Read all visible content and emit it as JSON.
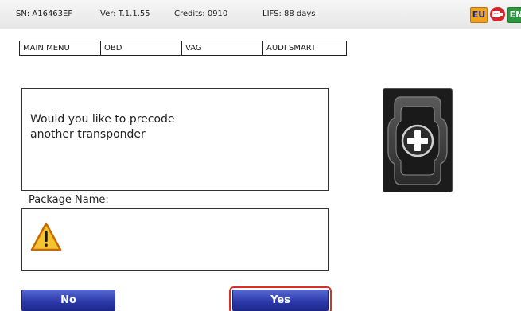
{
  "status": {
    "sn": "SN: A16463EF",
    "ver": "Ver: T.1.1.55",
    "credits": "Credits: 0910",
    "lifs": "LIFS: 88 days",
    "flag_eu": "EU",
    "flag_en": "EN"
  },
  "breadcrumb": [
    "MAIN MENU",
    "OBD",
    "VAG",
    "AUDI SMART"
  ],
  "message": {
    "line1": "Would you like to precode",
    "line2": "another transponder"
  },
  "package": {
    "label": "Package Name:"
  },
  "buttons": {
    "no": "No",
    "yes": "Yes"
  },
  "icons": {
    "usb": "usb-icon",
    "warning": "warning-icon",
    "key": "smart-key-image"
  },
  "colors": {
    "button_blue": "#2b37a8",
    "highlight_red": "#d9302a",
    "warning_yellow": "#f4c430"
  }
}
